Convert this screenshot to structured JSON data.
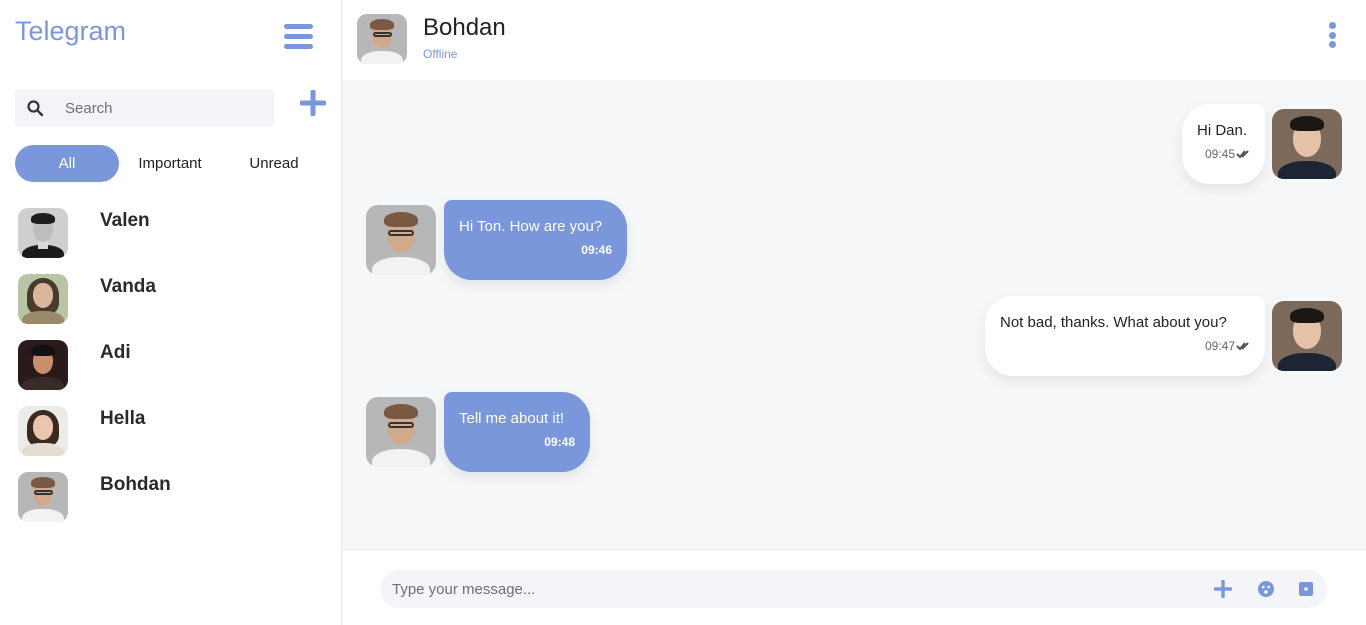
{
  "sidebar": {
    "brand": "Telegram",
    "search": {
      "placeholder": "Search"
    },
    "filters": [
      {
        "label": "All",
        "active": true
      },
      {
        "label": "Important",
        "active": false
      },
      {
        "label": "Unread",
        "active": false
      }
    ],
    "contacts": [
      {
        "name": "Valen"
      },
      {
        "name": "Vanda"
      },
      {
        "name": "Adi"
      },
      {
        "name": "Hella"
      },
      {
        "name": "Bohdan"
      }
    ]
  },
  "header": {
    "name": "Bohdan",
    "status": "Offline"
  },
  "messages": [
    {
      "direction": "out",
      "text": "Hi Dan.",
      "time": "09:45"
    },
    {
      "direction": "in",
      "text": "Hi Ton. How are you?",
      "time": "09:46"
    },
    {
      "direction": "out",
      "text": "Not bad, thanks. What about you?",
      "time": "09:47"
    },
    {
      "direction": "in",
      "text": "Tell me about it!",
      "time": "09:48"
    }
  ],
  "composer": {
    "placeholder": "Type your message..."
  },
  "colors": {
    "accent": "#7b97dc",
    "chat_bg": "#f6f7f9"
  }
}
